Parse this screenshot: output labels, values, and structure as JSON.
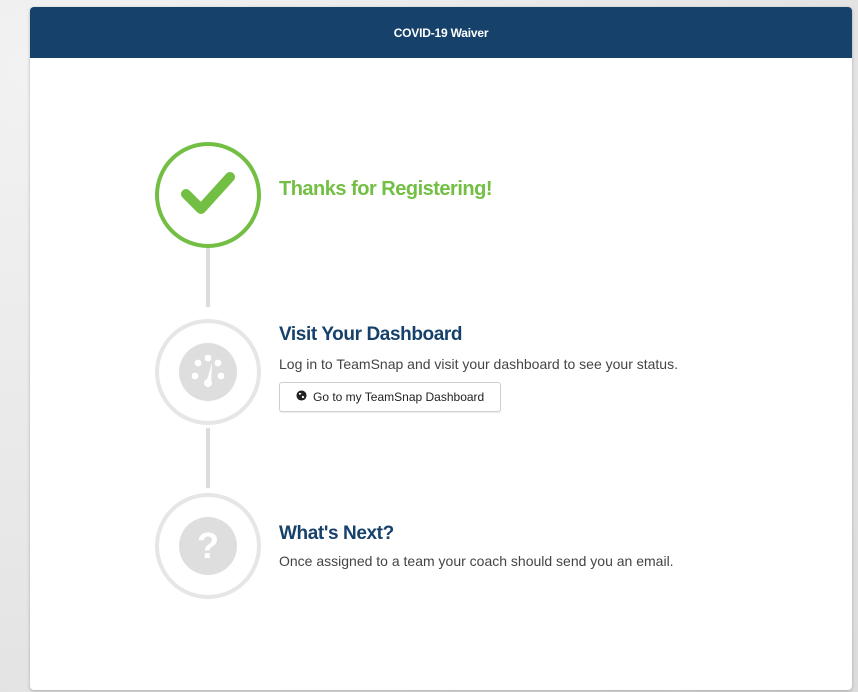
{
  "header": {
    "title": "COVID-19 Waiver"
  },
  "steps": [
    {
      "status": "complete",
      "icon": "checkmark-icon",
      "title": "Thanks for Registering!"
    },
    {
      "status": "pending",
      "icon": "dashboard-gauge-icon",
      "title": "Visit Your Dashboard",
      "description": "Log in to TeamSnap and visit your dashboard to see your status.",
      "button_label": "Go to my TeamSnap Dashboard",
      "button_icon": "globe-icon"
    },
    {
      "status": "pending",
      "icon": "question-mark-icon",
      "title": "What's Next?",
      "description": "Once assigned to a team your coach should send you an email."
    }
  ],
  "colors": {
    "header_bg": "#16416b",
    "success_green": "#72bf44",
    "navy_title": "#16416b",
    "inactive_gray": "#dedede"
  }
}
